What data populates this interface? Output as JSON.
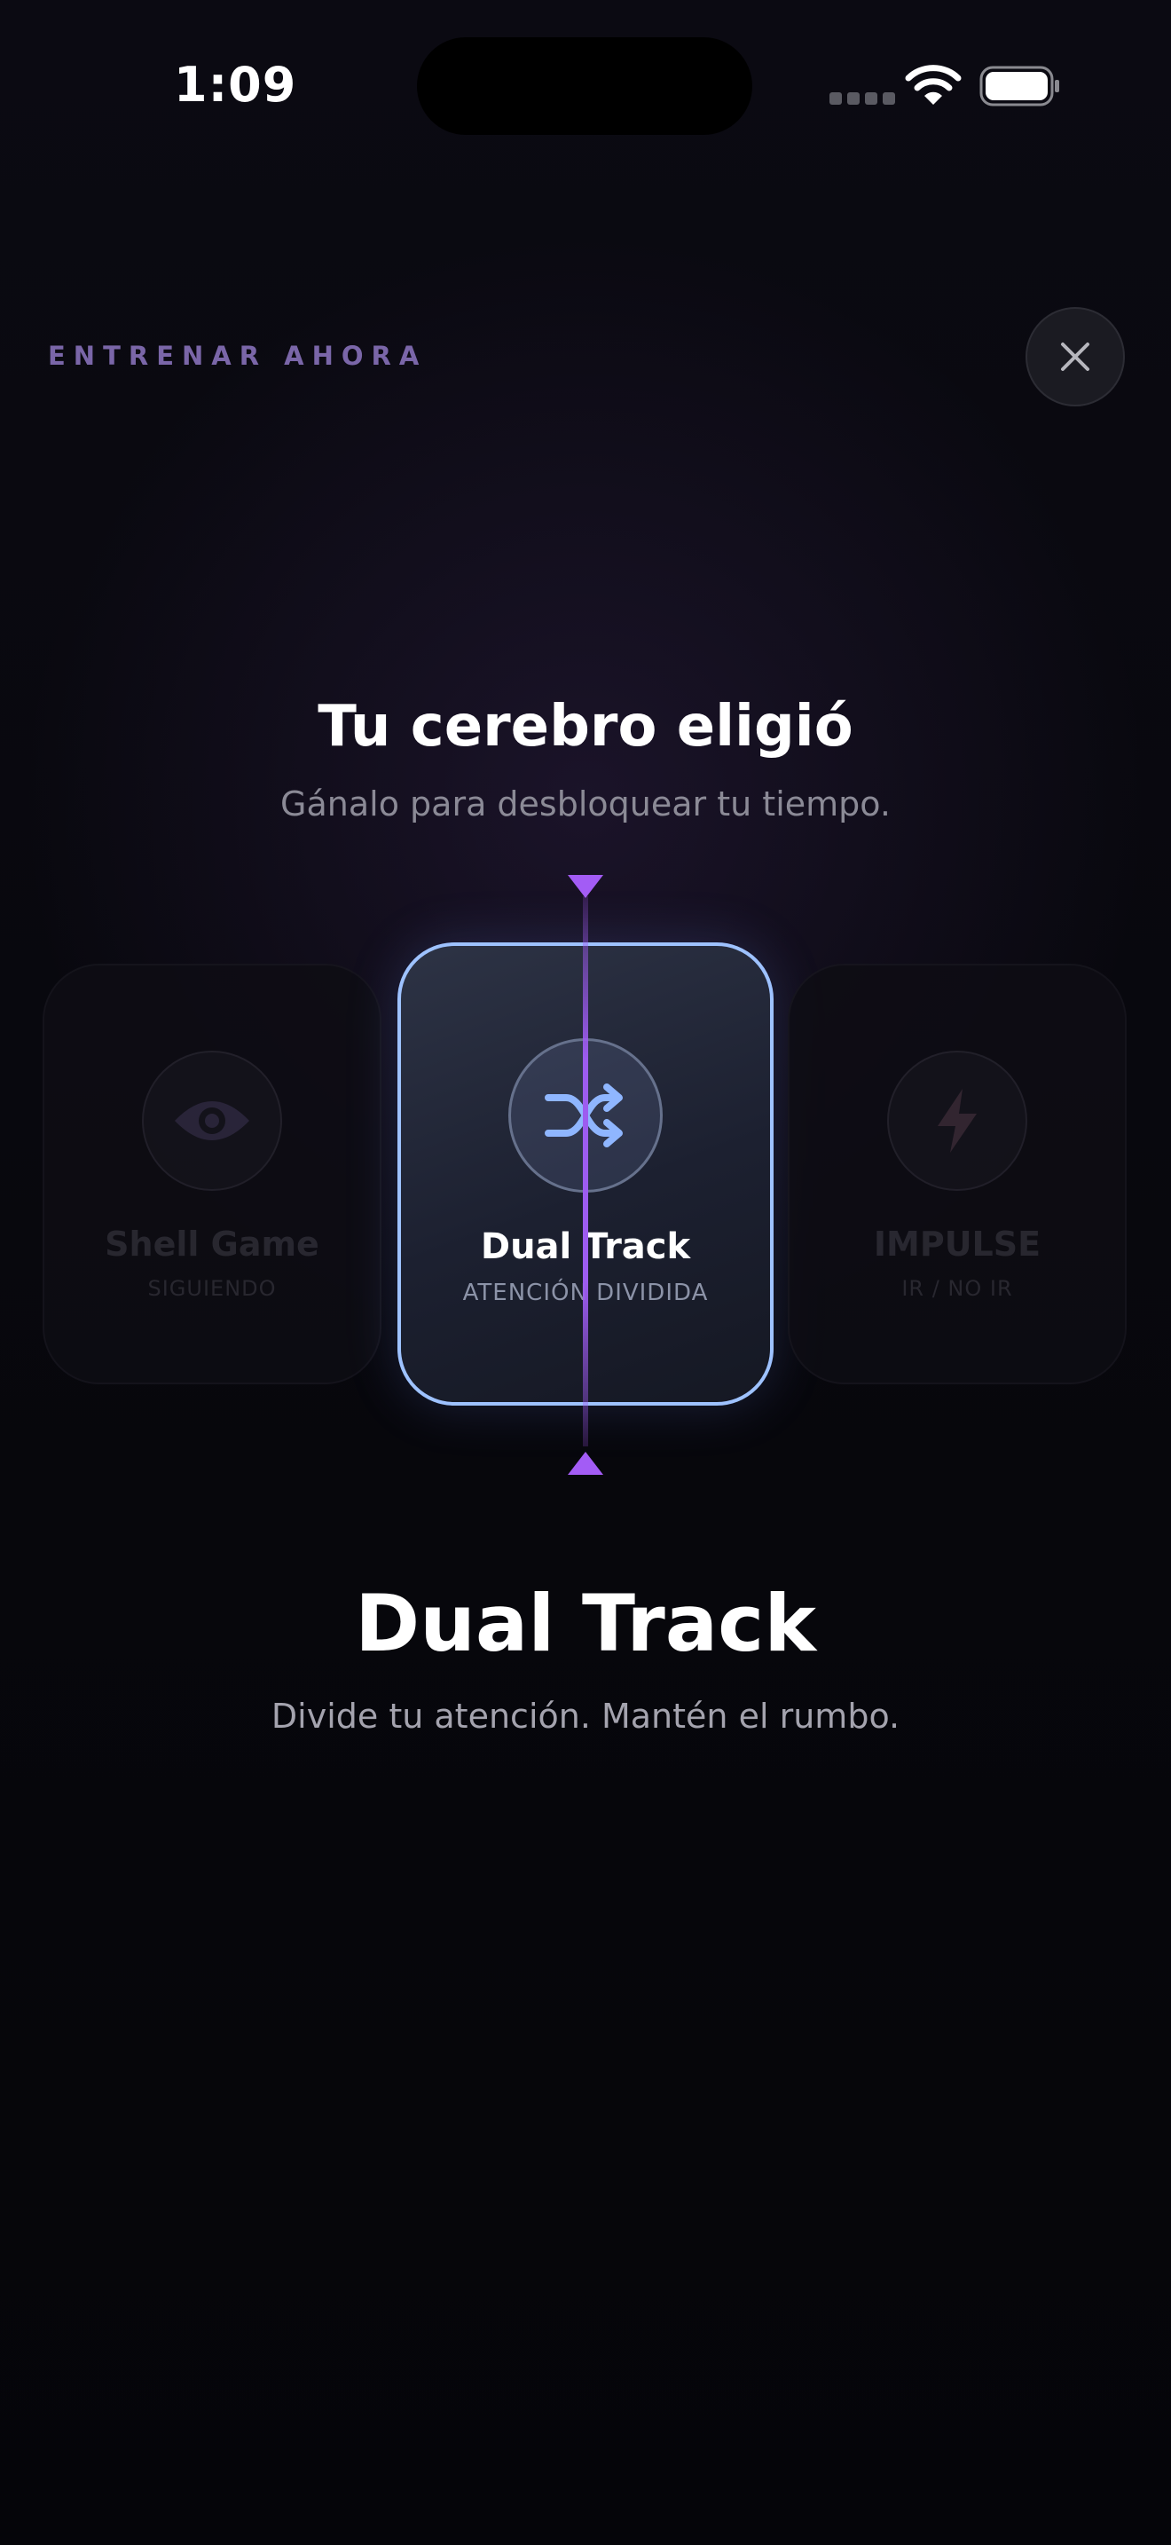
{
  "status_bar": {
    "time": "1:09"
  },
  "header": {
    "eyebrow": "ENTRENAR AHORA"
  },
  "intro": {
    "title": "Tu cerebro eligió",
    "subtitle": "Gánalo para desbloquear tu tiempo."
  },
  "carousel": {
    "cards": [
      {
        "title": "Shell Game",
        "tag": "SIGUIENDO",
        "icon": "eye-icon"
      },
      {
        "title": "Dual Track",
        "tag": "ATENCIÓN DIVIDIDA",
        "icon": "shuffle-icon"
      },
      {
        "title": "IMPULSE",
        "tag": "IR / NO IR",
        "icon": "lightning-icon"
      }
    ],
    "selected_index": 1
  },
  "selected": {
    "name": "Dual Track",
    "description": "Divide tu atención. Mantén el rumbo."
  },
  "colors": {
    "accent_purple": "#9d5cf0",
    "selected_border": "#9ec2ff",
    "shuffle_icon": "#8fb6ff",
    "eyebrow": "#7a66a8"
  }
}
